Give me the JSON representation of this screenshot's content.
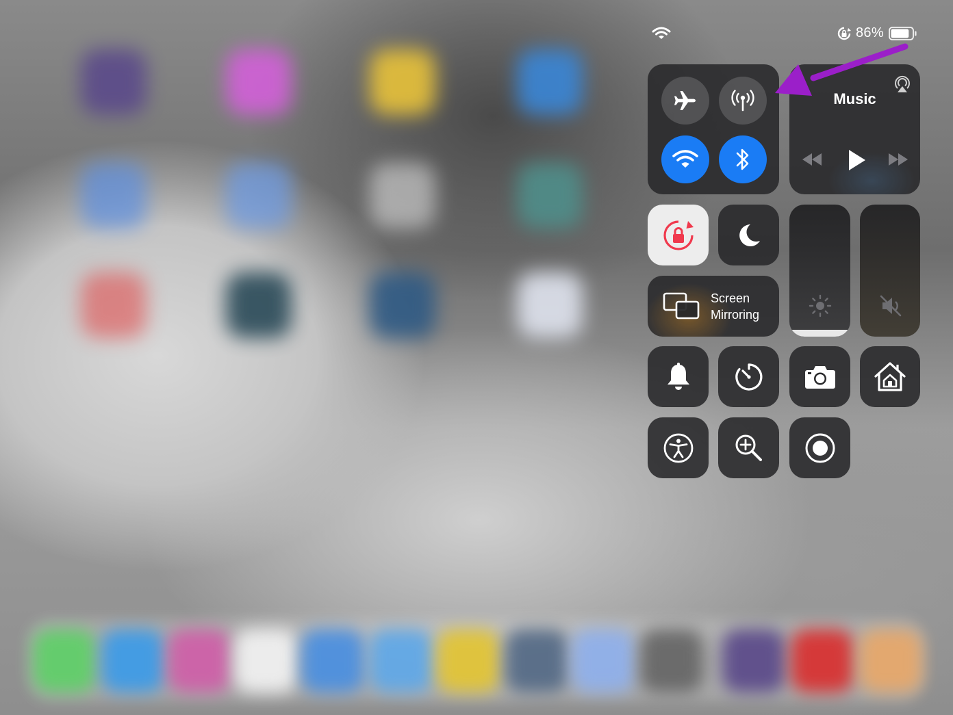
{
  "status_bar": {
    "battery_percent": "86%",
    "battery_level": 0.86,
    "icons": [
      "wifi-icon",
      "rotation-lock-icon",
      "battery-icon"
    ]
  },
  "control_center": {
    "connectivity": {
      "airplane_mode": {
        "icon": "airplane-icon",
        "on": false
      },
      "cellular_data": {
        "icon": "antenna-icon",
        "on": false
      },
      "wifi": {
        "icon": "wifi-icon",
        "on": true
      },
      "bluetooth": {
        "icon": "bluetooth-icon",
        "on": true
      }
    },
    "music": {
      "title": "Music",
      "icons": [
        "airplay-icon",
        "rewind-icon",
        "play-icon",
        "fast-forward-icon"
      ]
    },
    "rotation_lock": {
      "icon": "rotation-lock-icon",
      "on": true
    },
    "do_not_disturb": {
      "icon": "moon-icon",
      "on": false
    },
    "screen_mirroring": {
      "label_line1": "Screen",
      "label_line2": "Mirroring",
      "icon": "screen-mirroring-icon"
    },
    "brightness": {
      "icon": "sun-icon",
      "level": 0.05
    },
    "volume": {
      "icon": "speaker-muted-icon",
      "muted": true
    },
    "shortcuts": [
      {
        "icon": "bell-icon"
      },
      {
        "icon": "timer-icon"
      },
      {
        "icon": "camera-icon"
      },
      {
        "icon": "home-icon"
      },
      {
        "icon": "accessibility-icon"
      },
      {
        "icon": "magnifier-icon"
      },
      {
        "icon": "screen-record-icon"
      }
    ]
  },
  "colors": {
    "accent_blue": "#1a7cf5",
    "rotation_lock_red": "#f0394d",
    "annotation_purple": "#9b1fc9"
  }
}
